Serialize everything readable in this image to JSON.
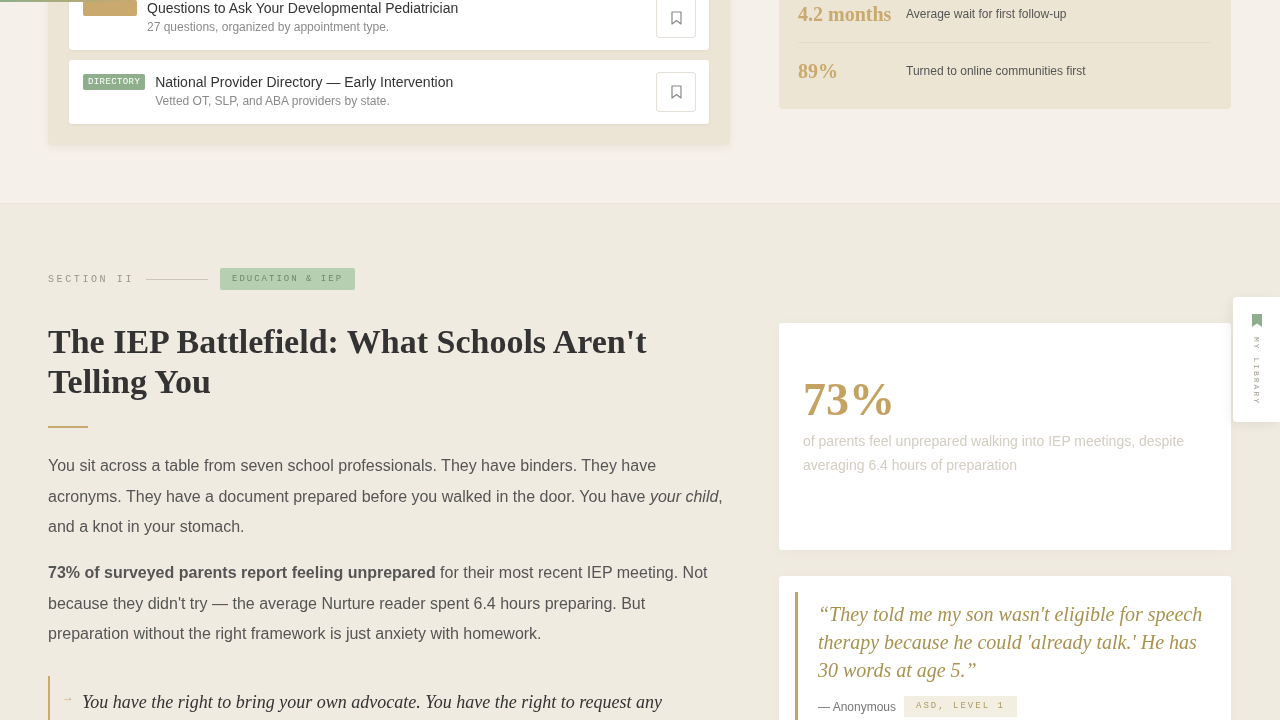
{
  "reading_progress": {
    "level": 0.105
  },
  "resources": [
    {
      "color": "#c9a96e",
      "title": "Questions to Ask Your Developmental Pediatrician",
      "description": "27 questions, organized by appointment type.",
      "saved": false
    },
    {
      "tag": "DIRECTORY",
      "color": "#8fae8b",
      "title": "National Provider Directory — Early Intervention",
      "description": "Vetted OT, SLP, and ABA providers by state.",
      "saved": false
    }
  ],
  "stats": [
    {
      "value": "4.2 months",
      "label": "Average wait for first follow-up"
    },
    {
      "value": "89%",
      "label": "Turned to online communities first"
    }
  ],
  "section": {
    "number": "SECTION II",
    "category": "EDUCATION & IEP",
    "title": "The IEP Battlefield: What Schools Aren't Telling You",
    "paragraphs": [
      "You sit across a table from seven school professionals. They have binders. They have acronyms. They have a document prepared before you walked in the door. You have *your child*, and a knot in your stomach.",
      "**73% of surveyed parents report feeling unprepared** for their most recent IEP meeting. Not because they didn't try — the average Nurture reader spent 6.4 hours preparing. But preparation without the right framework is just anxiety with homework."
    ],
    "callout": {
      "marker": "→",
      "text": "You have the right to bring your own advocate. You have the right to request any"
    }
  },
  "stat_card": {
    "value": "73%",
    "description": "of parents feel unprepared walking into IEP meetings, despite averaging 6.4 hours of preparation"
  },
  "testimonial": {
    "quote": "“They told me my son wasn't eligible for speech therapy because he could 'already talk.' He has 30 words at age 5.”",
    "author": "— Anonymous",
    "tag": "ASD, LEVEL 1"
  },
  "library_tab": {
    "label": "MY LIBRARY"
  }
}
